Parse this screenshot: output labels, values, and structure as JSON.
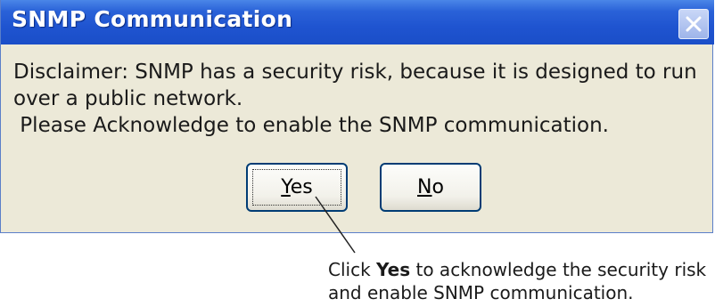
{
  "dialog": {
    "title": "SNMP Communication",
    "close_icon": "close-icon",
    "message": {
      "line1": "Disclaimer: SNMP has a security risk, because it is designed to run",
      "line2": "over a public network.",
      "line3": " Please Acknowledge to enable the SNMP communication."
    },
    "yes_button": {
      "mnemonic": "Y",
      "rest": "es"
    },
    "no_button": {
      "mnemonic": "N",
      "rest": "o"
    }
  },
  "callout": {
    "prefix": "Click ",
    "emphasis": "Yes",
    "suffix": " to acknowledge the security risk",
    "line2": "and enable SNMP communication."
  },
  "colors": {
    "titlebar": "#1f54d0",
    "dialog_bg": "#ece9d8",
    "button_border": "#003c74",
    "close_button": "#9eb4ea"
  }
}
